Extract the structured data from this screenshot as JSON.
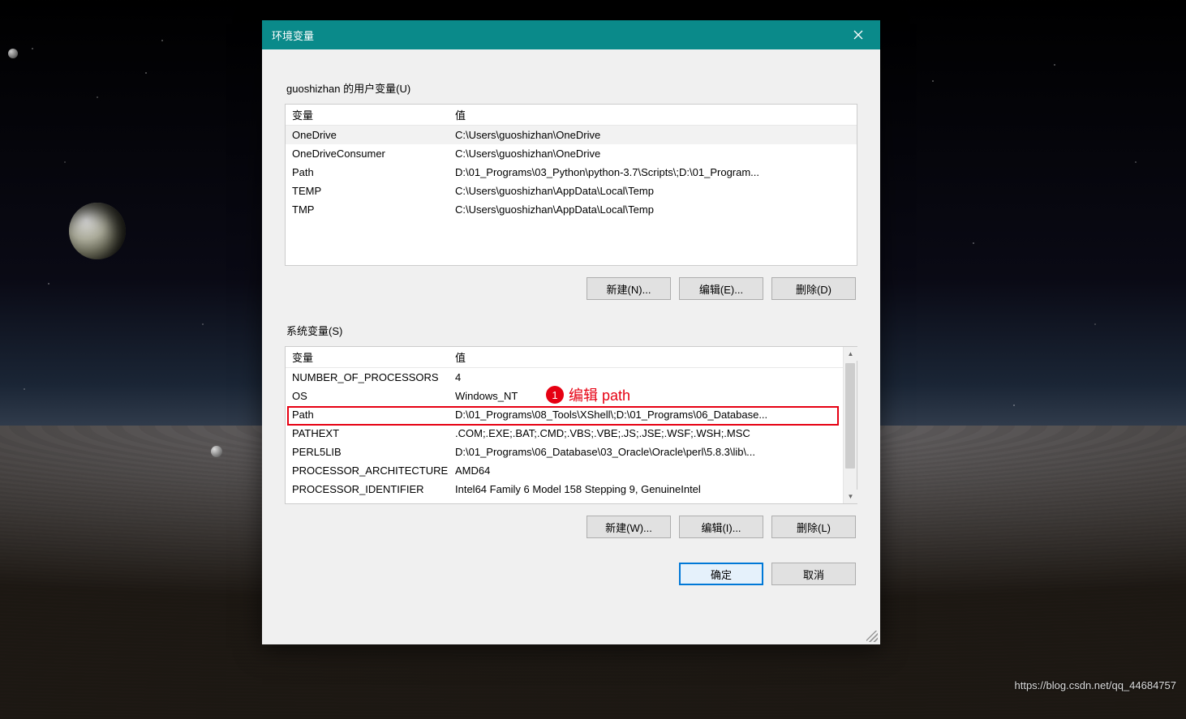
{
  "window": {
    "title": "环境变量"
  },
  "userVars": {
    "label": "guoshizhan 的用户变量(U)",
    "header": {
      "var": "变量",
      "val": "值"
    },
    "rows": [
      {
        "var": "OneDrive",
        "val": "C:\\Users\\guoshizhan\\OneDrive"
      },
      {
        "var": "OneDriveConsumer",
        "val": "C:\\Users\\guoshizhan\\OneDrive"
      },
      {
        "var": "Path",
        "val": "D:\\01_Programs\\03_Python\\python-3.7\\Scripts\\;D:\\01_Program..."
      },
      {
        "var": "TEMP",
        "val": "C:\\Users\\guoshizhan\\AppData\\Local\\Temp"
      },
      {
        "var": "TMP",
        "val": "C:\\Users\\guoshizhan\\AppData\\Local\\Temp"
      }
    ],
    "buttons": {
      "new": "新建(N)...",
      "edit": "编辑(E)...",
      "del": "删除(D)"
    }
  },
  "sysVars": {
    "label": "系统变量(S)",
    "header": {
      "var": "变量",
      "val": "值"
    },
    "rows": [
      {
        "var": "NUMBER_OF_PROCESSORS",
        "val": "4"
      },
      {
        "var": "OS",
        "val": "Windows_NT"
      },
      {
        "var": "Path",
        "val": "D:\\01_Programs\\08_Tools\\XShell\\;D:\\01_Programs\\06_Database..."
      },
      {
        "var": "PATHEXT",
        "val": ".COM;.EXE;.BAT;.CMD;.VBS;.VBE;.JS;.JSE;.WSF;.WSH;.MSC"
      },
      {
        "var": "PERL5LIB",
        "val": "D:\\01_Programs\\06_Database\\03_Oracle\\Oracle\\perl\\5.8.3\\lib\\..."
      },
      {
        "var": "PROCESSOR_ARCHITECTURE",
        "val": "AMD64"
      },
      {
        "var": "PROCESSOR_IDENTIFIER",
        "val": "Intel64 Family 6 Model 158 Stepping 9, GenuineIntel"
      }
    ],
    "buttons": {
      "new": "新建(W)...",
      "edit": "编辑(I)...",
      "del": "删除(L)"
    }
  },
  "dialogButtons": {
    "ok": "确定",
    "cancel": "取消"
  },
  "annotation": {
    "num": "1",
    "text": "编辑 path"
  },
  "watermark": "https://blog.csdn.net/qq_44684757"
}
